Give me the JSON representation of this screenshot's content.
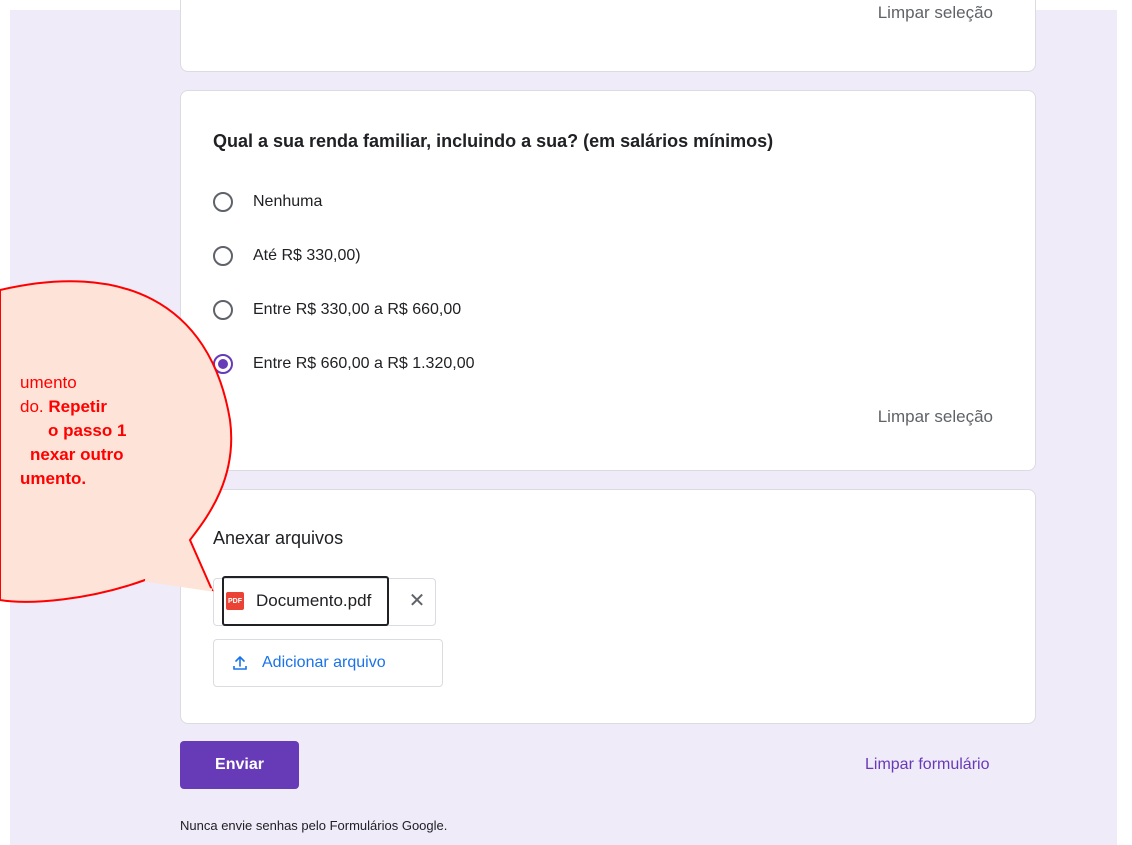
{
  "form": {
    "clear_selection_top": "Limpar seleção",
    "question": {
      "title": "Qual a sua renda familiar, incluindo a sua? (em salários mínimos)",
      "options": [
        {
          "label": "Nenhuma",
          "checked": false
        },
        {
          "label": "Até R$ 330,00)",
          "checked": false
        },
        {
          "label": "Entre R$ 330,00 a R$ 660,00",
          "checked": false
        },
        {
          "label": "Entre R$ 660,00 a R$ 1.320,00",
          "checked": true
        }
      ],
      "clear_selection": "Limpar seleção"
    },
    "file_upload": {
      "title": "Anexar arquivos",
      "file_name": "Documento.pdf",
      "file_icon_text": "PDF",
      "remove_icon": "close-icon",
      "add_file_label": "Adicionar arquivo",
      "add_file_icon": "upload-icon"
    },
    "submit_label": "Enviar",
    "clear_form_label": "Limpar formulário",
    "footer_note": "Nunca envie senhas pelo Formulários Google."
  },
  "callout": {
    "line1": "umento",
    "line2_normal": "do. ",
    "line2_bold": "Repetir",
    "line3": "o passo 1",
    "line4": "nexar outro",
    "line5": "umento."
  },
  "colors": {
    "accent": "#673ab7",
    "background": "#f0ebf8",
    "link_blue": "#1a73e8",
    "callout_fill": "#fde3d8",
    "callout_stroke": "#ff0000"
  }
}
